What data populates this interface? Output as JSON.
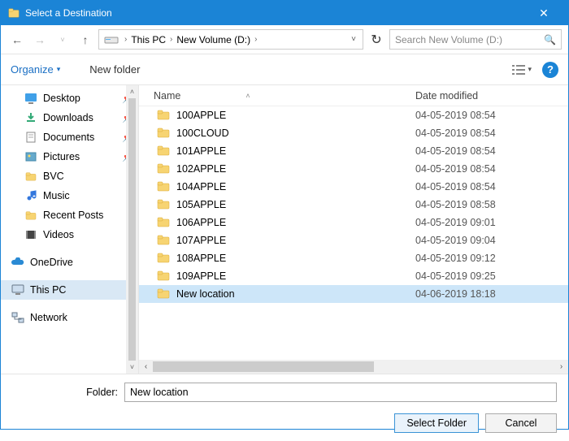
{
  "title": "Select a Destination",
  "breadcrumb": {
    "root": "This PC",
    "volume": "New Volume (D:)"
  },
  "search": {
    "placeholder": "Search New Volume (D:)"
  },
  "toolbar": {
    "organize": "Organize",
    "newfolder": "New folder"
  },
  "columns": {
    "name": "Name",
    "date": "Date modified"
  },
  "tree": {
    "desktop": "Desktop",
    "downloads": "Downloads",
    "documents": "Documents",
    "pictures": "Pictures",
    "bvc": "BVC",
    "music": "Music",
    "recent": "Recent Posts",
    "videos": "Videos",
    "onedrive": "OneDrive",
    "thispc": "This PC",
    "network": "Network"
  },
  "files": [
    {
      "name": "100APPLE",
      "date": "04-05-2019 08:54"
    },
    {
      "name": "100CLOUD",
      "date": "04-05-2019 08:54"
    },
    {
      "name": "101APPLE",
      "date": "04-05-2019 08:54"
    },
    {
      "name": "102APPLE",
      "date": "04-05-2019 08:54"
    },
    {
      "name": "104APPLE",
      "date": "04-05-2019 08:54"
    },
    {
      "name": "105APPLE",
      "date": "04-05-2019 08:58"
    },
    {
      "name": "106APPLE",
      "date": "04-05-2019 09:01"
    },
    {
      "name": "107APPLE",
      "date": "04-05-2019 09:04"
    },
    {
      "name": "108APPLE",
      "date": "04-05-2019 09:12"
    },
    {
      "name": "109APPLE",
      "date": "04-05-2019 09:25"
    },
    {
      "name": "New location",
      "date": "04-06-2019 18:18"
    }
  ],
  "selected_index": 10,
  "folder_label": "Folder:",
  "folder_value": "New location",
  "buttons": {
    "select": "Select Folder",
    "cancel": "Cancel"
  }
}
